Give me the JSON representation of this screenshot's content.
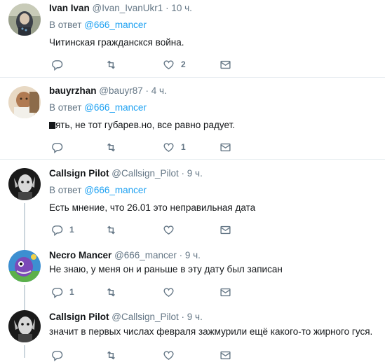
{
  "tweets": [
    {
      "name": "Ivan Ivan",
      "handle": "@Ivan_IvanUkr1",
      "time": "· 10 ч.",
      "reply_prefix": "В ответ",
      "reply_to": "@666_mancer",
      "text": "Читинская гражданскся война.",
      "replies": "",
      "retweets": "",
      "likes": "2"
    },
    {
      "name": "bauyrzhan",
      "handle": "@bauyr87",
      "time": "· 4 ч.",
      "reply_prefix": "В ответ",
      "reply_to": "@666_mancer",
      "text_tail": "ять, не тот губарев.но, все равно радует.",
      "replies": "",
      "retweets": "",
      "likes": "1"
    },
    {
      "name": "Callsign Pilot",
      "handle": "@Callsign_Pilot",
      "time": "· 9 ч.",
      "reply_prefix": "В ответ",
      "reply_to": "@666_mancer",
      "text": "Есть мнение, что 26.01 это неправильная дата",
      "replies": "1",
      "retweets": "",
      "likes": ""
    },
    {
      "name": "Necro Mancer",
      "handle": "@666_mancer",
      "time": "· 9 ч.",
      "text": "Не знаю, у меня он и раньше в эту дату был записан",
      "replies": "1",
      "retweets": "",
      "likes": ""
    },
    {
      "name": "Callsign Pilot",
      "handle": "@Callsign_Pilot",
      "time": "· 9 ч.",
      "text": "значит в первых числах февраля зажмурили ещё какого-то жирного гуся.",
      "replies": "",
      "retweets": "",
      "likes": ""
    }
  ],
  "icons": {
    "reply": "reply-icon",
    "retweet": "retweet-icon",
    "like": "heart-icon",
    "dm": "envelope-icon"
  },
  "colors": {
    "link": "#1da1f2",
    "muted": "#657786",
    "text": "#14171a",
    "thread_line": "#ccd6dd"
  }
}
